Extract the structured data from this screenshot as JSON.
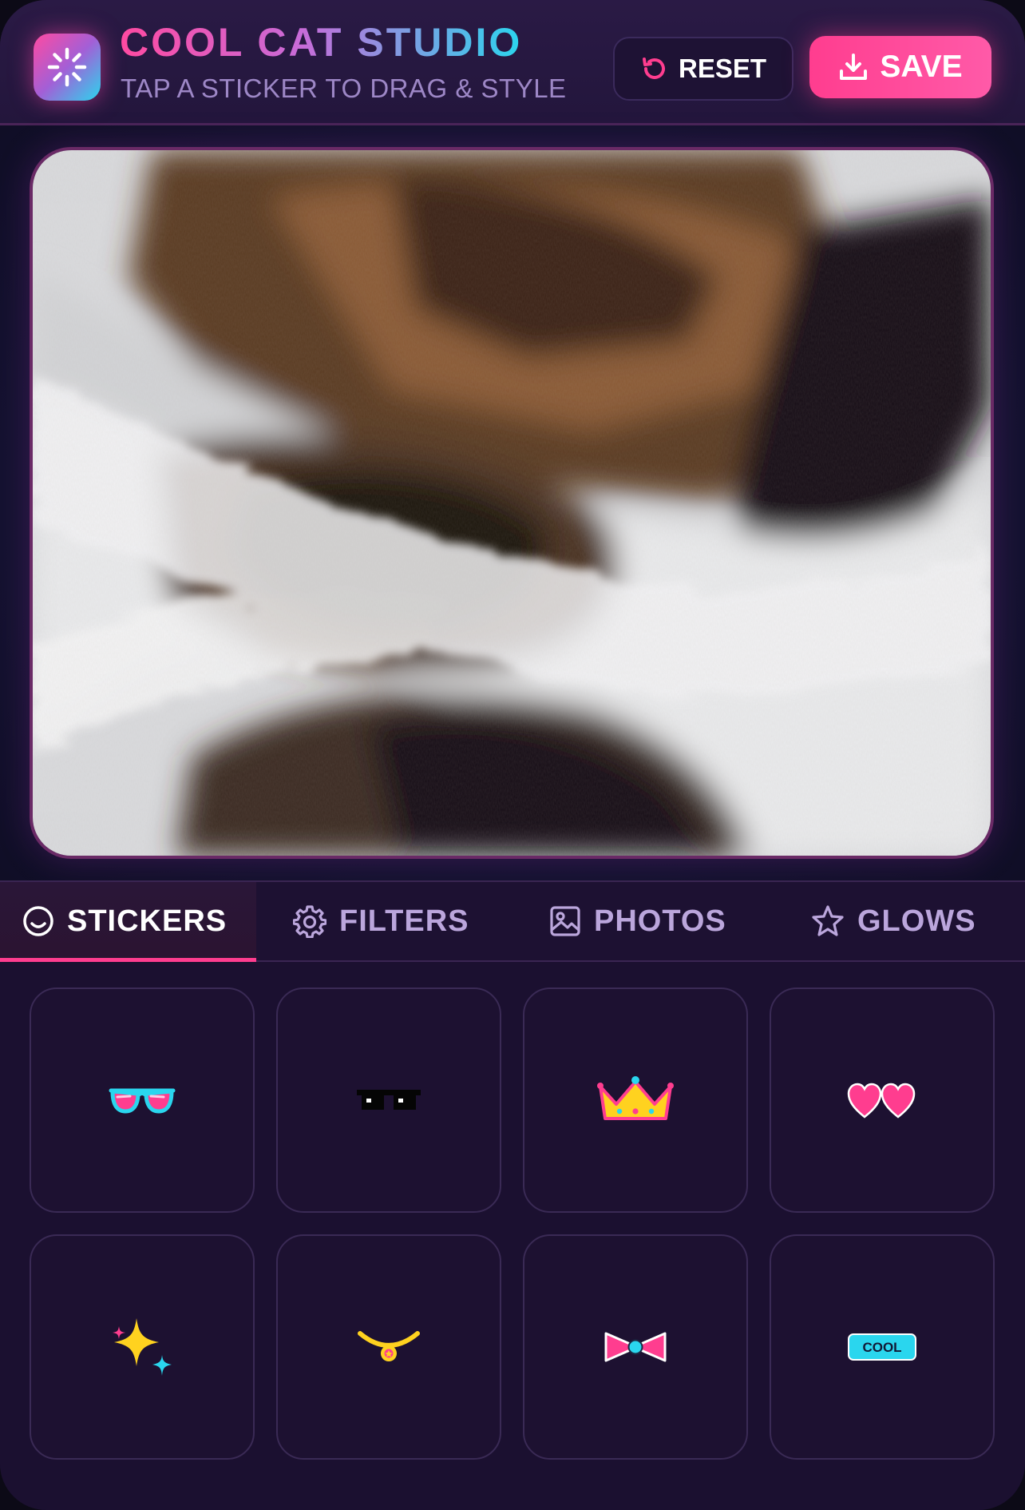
{
  "header": {
    "title": "COOL CAT STUDIO",
    "subtitle": "TAP A STICKER TO DRAG & STYLE",
    "logo_icon": "sparkle-burst-icon",
    "reset_label": "RESET",
    "reset_icon": "rotate-ccw-icon",
    "save_label": "SAVE",
    "save_icon": "download-icon"
  },
  "canvas": {
    "image_icon": "photo-cat-fur"
  },
  "tabs": [
    {
      "label": "STICKERS",
      "icon": "smiley-icon",
      "active": true
    },
    {
      "label": "FILTERS",
      "icon": "gear-icon",
      "active": false
    },
    {
      "label": "PHOTOS",
      "icon": "image-icon",
      "active": false
    },
    {
      "label": "GLOWS",
      "icon": "star-icon",
      "active": false
    }
  ],
  "stickers": [
    {
      "icon": "heart-sunglasses-icon"
    },
    {
      "icon": "pixel-sunglasses-icon"
    },
    {
      "icon": "crown-icon"
    },
    {
      "icon": "double-heart-icon"
    },
    {
      "icon": "sparkles-icon"
    },
    {
      "icon": "necklace-icon"
    },
    {
      "icon": "bow-tie-icon"
    },
    {
      "icon": "cool-badge-icon",
      "text": "COOL"
    }
  ],
  "colors": {
    "accent_pink": "#ff3d8f",
    "accent_cyan": "#2ad6ee",
    "background": "#1b1030",
    "tile_border": "#3a2a55"
  }
}
